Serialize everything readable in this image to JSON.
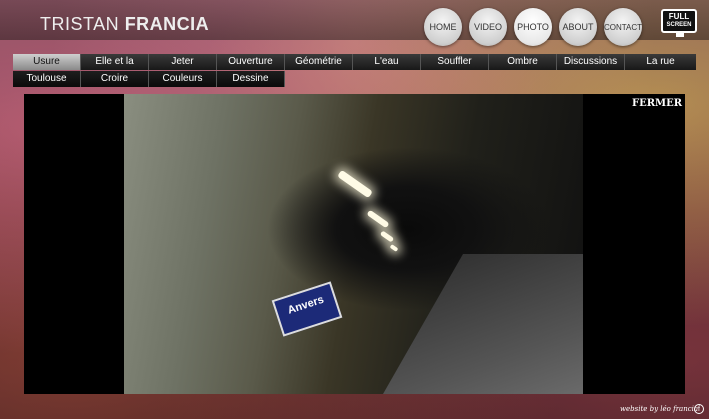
{
  "logo": {
    "first": "TRISTAN",
    "last": "FRANCIA"
  },
  "nav": [
    "HOME",
    "VIDEO",
    "PHOTO",
    "ABOUT",
    "CONTACT"
  ],
  "active_nav": "PHOTO",
  "fullscreen": {
    "line1": "FULL",
    "line2": "SCREEN"
  },
  "galleries_row1": [
    "Usure",
    "Elle et la",
    "Jeter",
    "Ouverture",
    "Géométrie",
    "L'eau",
    "Souffler",
    "Ombre",
    "Discussions",
    "La rue"
  ],
  "galleries_row2": [
    "Toulouse",
    "Croire",
    "Couleurs",
    "Dessine"
  ],
  "active_gallery": "Usure",
  "photo": {
    "sign_text": "Anvers"
  },
  "close_label": "FERMER",
  "footer": {
    "credit": "website by léo francia",
    "icon": "f-icon"
  }
}
